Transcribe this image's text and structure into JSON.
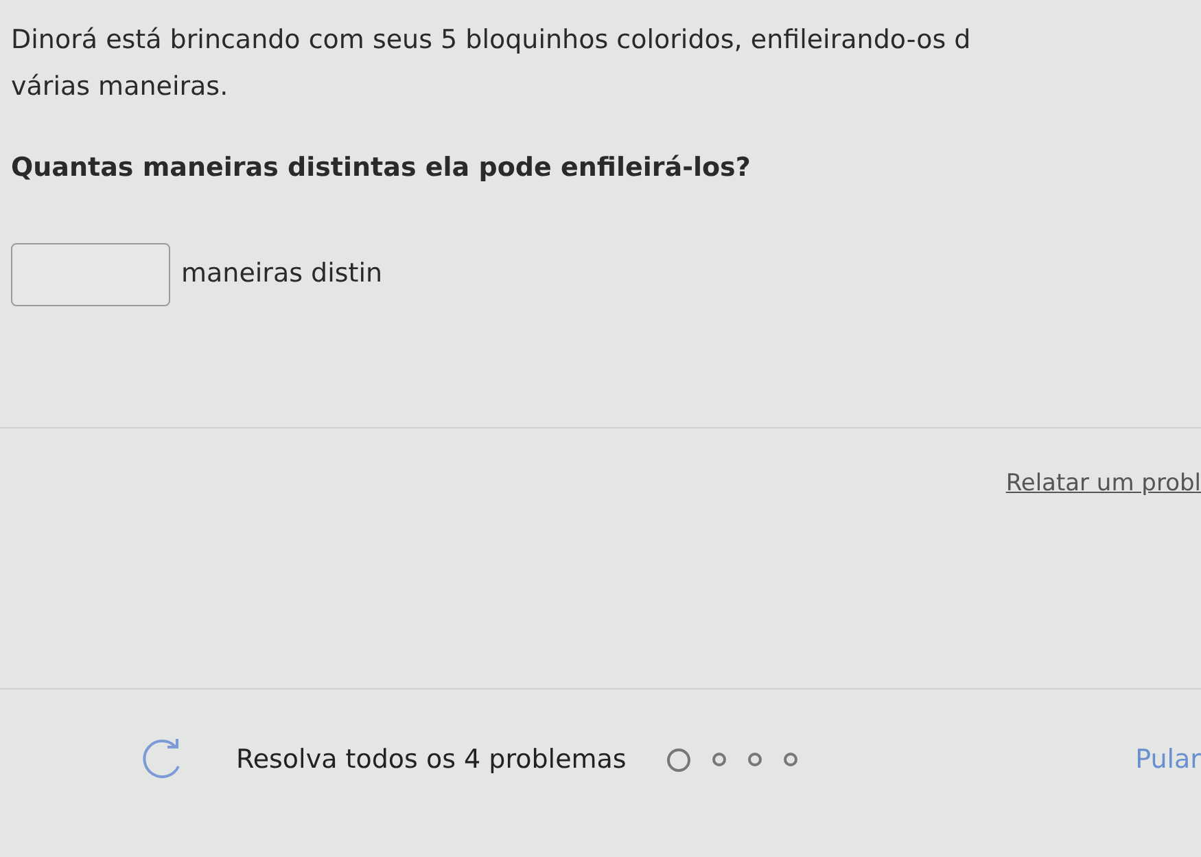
{
  "question": {
    "intro": "Dinorá está brincando com seus 5 bloquinhos coloridos, enfileirando-os d",
    "intro_2": "várias maneiras.",
    "prompt": "Quantas maneiras distintas ela pode enfileirá-los?"
  },
  "answer": {
    "suffix": "maneiras distin"
  },
  "report_link": "Relatar um probl",
  "footer": {
    "task": "Resolva todos os 4 problemas",
    "progress": [
      {
        "selected": true
      },
      {
        "selected": false
      },
      {
        "selected": false
      },
      {
        "selected": false
      }
    ],
    "skip": "Pular"
  }
}
